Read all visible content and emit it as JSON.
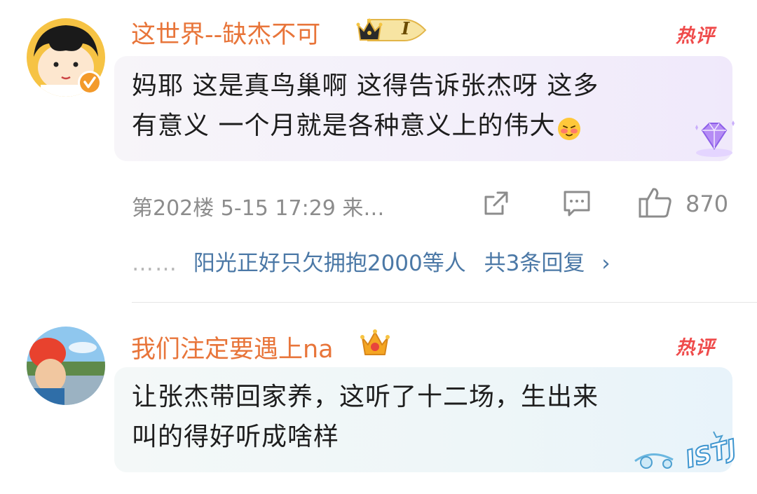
{
  "comments": [
    {
      "username": "这世界--缺杰不可",
      "level_badge": "I",
      "hot_badge": "热评",
      "content_line1": "妈耶 这是真鸟巢啊 这得告诉张杰呀 这多",
      "content_line2": "有意义 一个月就是各种意义上的伟大",
      "meta": "第202楼  5-15 17:29  来…",
      "likes": "870",
      "reply_dots": "……",
      "reply_user": "阳光正好只欠拥抱2000",
      "reply_suffix": "等人",
      "reply_total": "共3条回复",
      "reply_chevron": "›"
    },
    {
      "username": "我们注定要遇上na",
      "hot_badge": "热评",
      "content_line1": "让张杰带回家养，这听了十二场，生出来",
      "content_line2": "叫的得好听成啥样",
      "sticker_text": "ISTJ"
    }
  ],
  "colors": {
    "username": "#e8753a",
    "hot": "#ef4b4b",
    "reply_link": "#4b78a6",
    "meta": "#8c8c8c"
  },
  "icons": {
    "share": "share-icon",
    "comment": "comment-icon",
    "like": "thumbs-up-icon",
    "crown": "crown-icon",
    "diamond": "diamond-icon",
    "verified": "verified-badge-icon"
  }
}
